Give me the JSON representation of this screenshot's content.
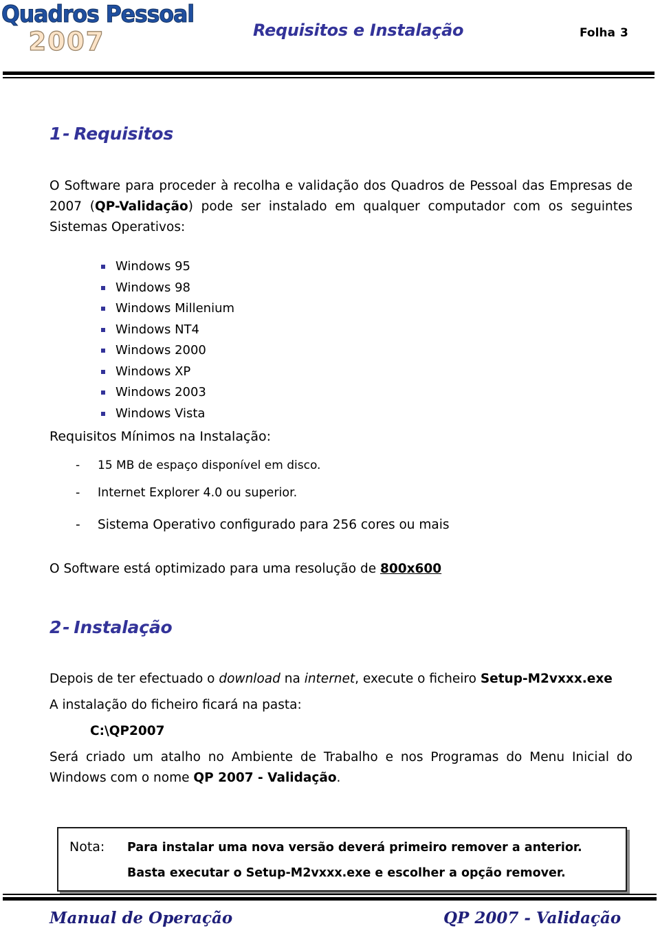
{
  "colors": {
    "heading_blue": "#333399",
    "logo_blue": "#1F4FA0",
    "logo_year_fill": "#FCE4C8",
    "footer_blue": "#1F1F7A",
    "bullet": "#333399",
    "text": "#000000"
  },
  "header": {
    "logo_line1": "Quadros Pessoal",
    "logo_line2": "2007",
    "title": "Requisitos e Instalação",
    "sheet_label": "Folha",
    "sheet_number": "3"
  },
  "sections": [
    {
      "number": "1",
      "dash": "-",
      "title": "Requisitos"
    },
    {
      "number": "2",
      "dash": "-",
      "title": "Instalação"
    }
  ],
  "intro": {
    "part1": "O Software para proceder à recolha e validação dos Quadros de Pessoal das Empresas de 2007 (",
    "bold1": "QP-Validação",
    "part2": ") pode ser instalado em qualquer computador com os seguintes Sistemas Operativos:"
  },
  "os_list": [
    {
      "label": "Windows 95"
    },
    {
      "label": "Windows 98"
    },
    {
      "label": "Windows Millenium"
    },
    {
      "label": "Windows NT4"
    },
    {
      "label": "Windows 2000"
    },
    {
      "label": "Windows XP"
    },
    {
      "label": "Windows 2003"
    },
    {
      "label": "Windows Vista"
    }
  ],
  "minimum": {
    "heading": "Requisitos Mínimos na Instalação:",
    "dash_marker": "-",
    "items": [
      {
        "label": "15 MB de espaço disponível em disco."
      },
      {
        "label": "Internet Explorer 4.0 ou superior."
      },
      {
        "label": "Sistema Operativo configurado para 256 cores ou mais"
      }
    ]
  },
  "resolution": {
    "text": "O Software está optimizado para uma resolução de ",
    "value": "800x600"
  },
  "install": {
    "line1_a": "Depois de ter efectuado o ",
    "line1_italic1": "download",
    "line1_b": " na ",
    "line1_italic2": "internet",
    "line1_c": ", execute o ficheiro ",
    "line1_bold": "Setup-M2vxxx.exe",
    "line2": "A instalação do ficheiro ficará na pasta:",
    "path": "C:\\QP2007",
    "line3_a": "Será criado um atalho no Ambiente de Trabalho e nos Programas do Menu Inicial do Windows com o nome ",
    "line3_bold": "QP 2007 - Validação",
    "line3_b": "."
  },
  "note": {
    "label": "Nota:",
    "line1": "Para instalar uma nova versão deverá primeiro remover a anterior.",
    "line2": "Basta executar o Setup-M2vxxx.exe e escolher a opção remover."
  },
  "footer": {
    "left": "Manual de Operação",
    "right": "QP 2007 - Validação"
  }
}
